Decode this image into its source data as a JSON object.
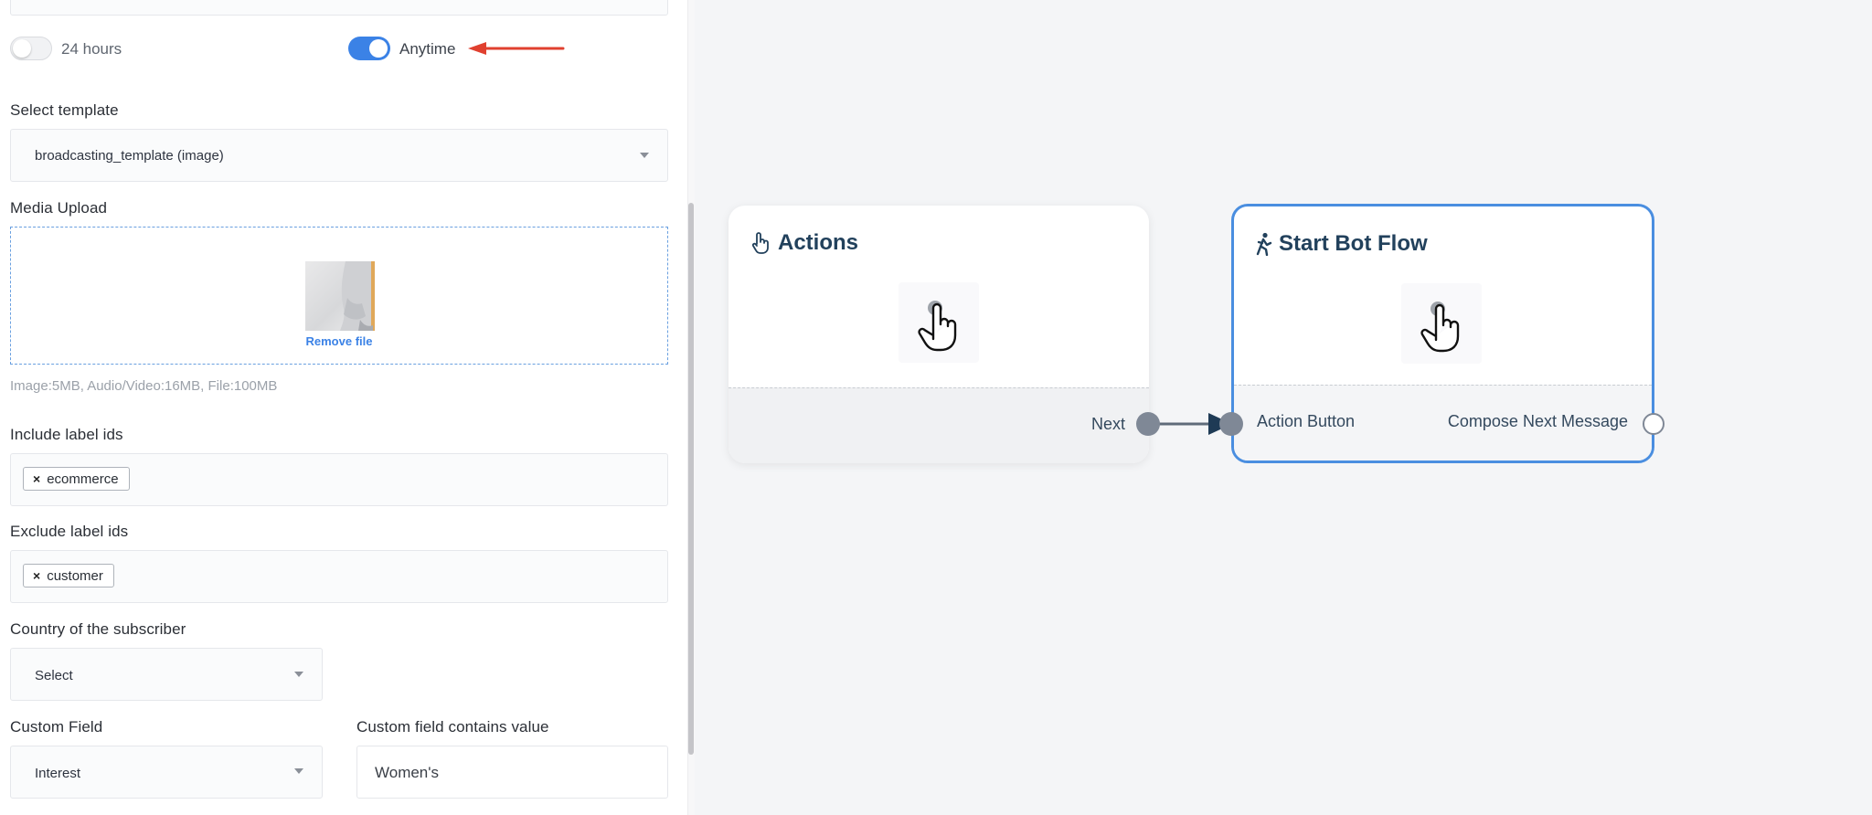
{
  "settings": {
    "toggle_24h": {
      "label": "24 hours",
      "on": false
    },
    "toggle_anytime": {
      "label": "Anytime",
      "on": true
    },
    "template": {
      "label": "Select template",
      "value": "broadcasting_template (image)"
    },
    "media": {
      "label": "Media Upload",
      "remove_label": "Remove file",
      "limits": "Image:5MB, Audio/Video:16MB, File:100MB"
    },
    "include_labels": {
      "label": "Include label ids",
      "chips": [
        "ecommerce"
      ]
    },
    "exclude_labels": {
      "label": "Exclude label ids",
      "chips": [
        "customer"
      ]
    },
    "country": {
      "label": "Country of the subscriber",
      "value": "Select"
    },
    "custom_field": {
      "label": "Custom Field",
      "value": "Interest"
    },
    "custom_value": {
      "label": "Custom field contains value",
      "value": "Women's"
    }
  },
  "canvas": {
    "actions_node": {
      "title": "Actions",
      "port_out": "Next",
      "icon": "pointer-hand-icon"
    },
    "bot_flow_node": {
      "title": "Start Bot Flow",
      "port_in": "Action Button",
      "port_out": "Compose Next Message",
      "icon": "walking-person-icon"
    }
  },
  "colors": {
    "accent": "#3b82e6",
    "node_title": "#22415c",
    "annotation_arrow": "#e0402f",
    "port": "#7f8896",
    "edge": "#5f6b7a"
  }
}
